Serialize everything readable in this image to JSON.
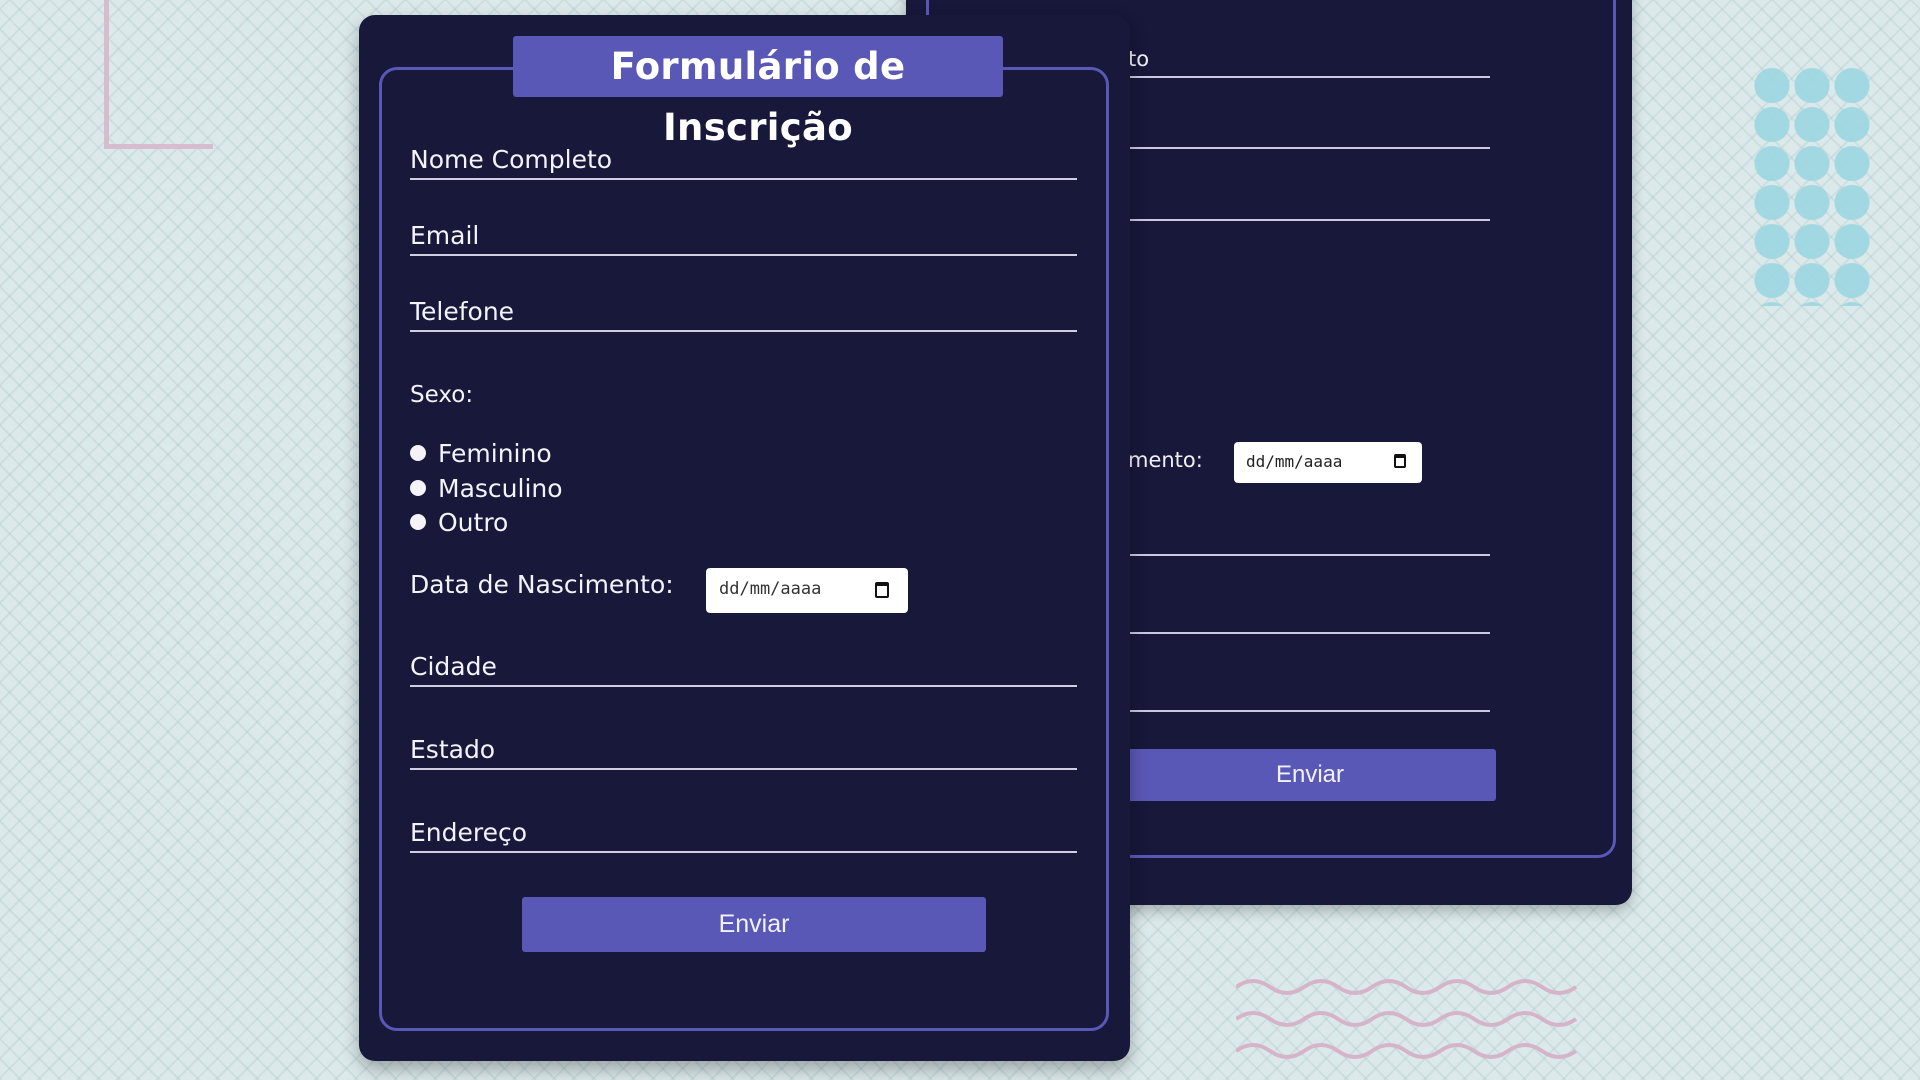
{
  "form": {
    "title": "Formulário de Inscrição",
    "fields": {
      "nome": "Nome Completo",
      "email": "Email",
      "telefone": "Telefone",
      "cidade": "Cidade",
      "estado": "Estado",
      "endereco": "Endereço"
    },
    "sexo_label": "Sexo:",
    "sexo_options": [
      "Feminino",
      "Masculino",
      "Outro"
    ],
    "dob_label": "Data de Nascimento:",
    "dob_placeholder": "dd/mm/aaaa",
    "submit_label": "Enviar"
  },
  "back_form": {
    "partial_field": "to",
    "partial_dob_label": "mento:",
    "dob_placeholder": "dd/mm/aaaa",
    "submit_label": "Enviar"
  },
  "colors": {
    "card": "#17183a",
    "accent": "#5a58b6",
    "background": "#dce9ea"
  }
}
